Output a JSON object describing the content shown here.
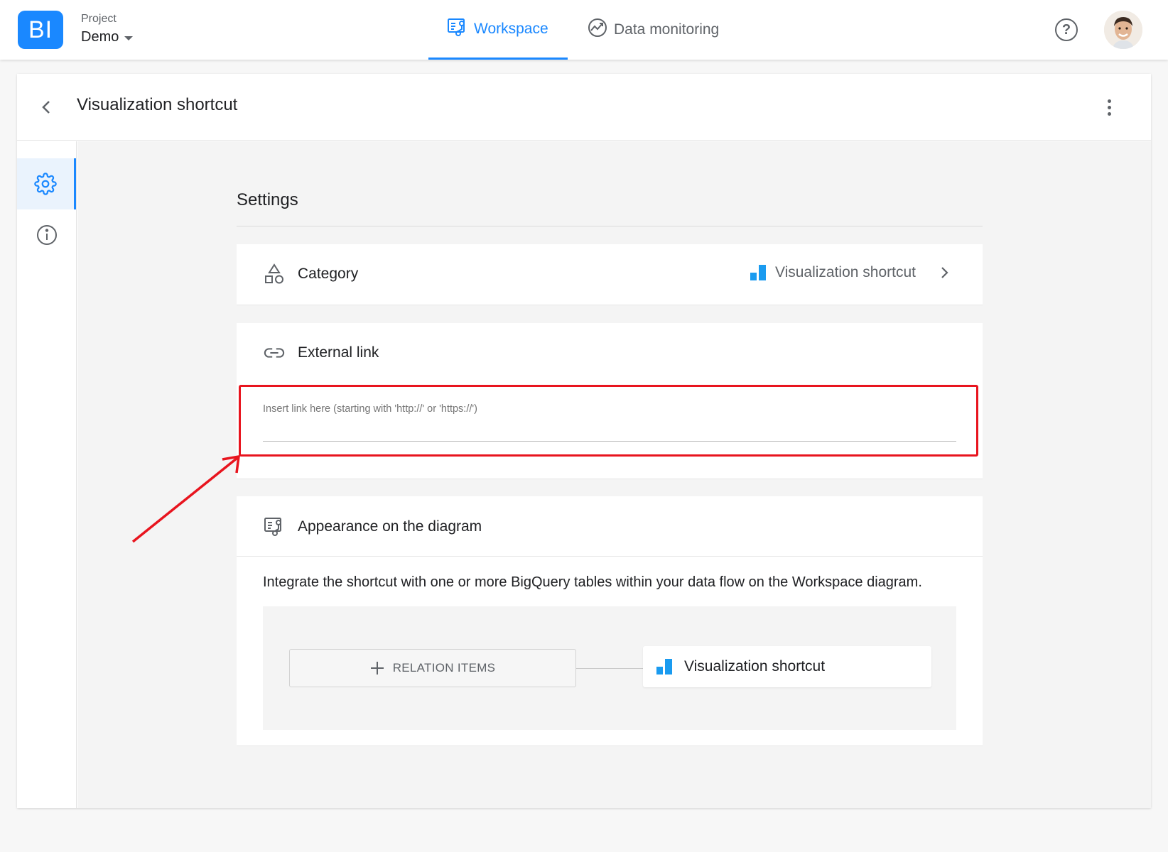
{
  "header": {
    "logo_text": "BI",
    "project_label": "Project",
    "project_name": "Demo",
    "tabs": [
      {
        "label": "Workspace",
        "active": true
      },
      {
        "label": "Data monitoring",
        "active": false
      }
    ],
    "help_icon": "help-circle-icon",
    "avatar": "user-avatar"
  },
  "page": {
    "title": "Visualization shortcut",
    "back_icon": "chevron-left-icon",
    "more_icon": "more-vertical-icon"
  },
  "sidenav": {
    "items": [
      {
        "icon": "gear-icon",
        "active": true
      },
      {
        "icon": "info-icon",
        "active": false
      }
    ]
  },
  "settings": {
    "title": "Settings",
    "category": {
      "label": "Category",
      "value": "Visualization shortcut"
    },
    "external_link": {
      "label": "External link",
      "placeholder": "Insert link here (starting with 'http://' or 'https://')",
      "value": ""
    },
    "appearance": {
      "label": "Appearance on the diagram",
      "description": "Integrate the shortcut with one or more BigQuery tables within your data flow on the Workspace diagram.",
      "relation_button": "RELATION ITEMS",
      "node_label": "Visualization shortcut"
    }
  },
  "colors": {
    "accent": "#1a88ff",
    "annotation": "#e8141e",
    "chart_icon": "#1a9bf0"
  }
}
